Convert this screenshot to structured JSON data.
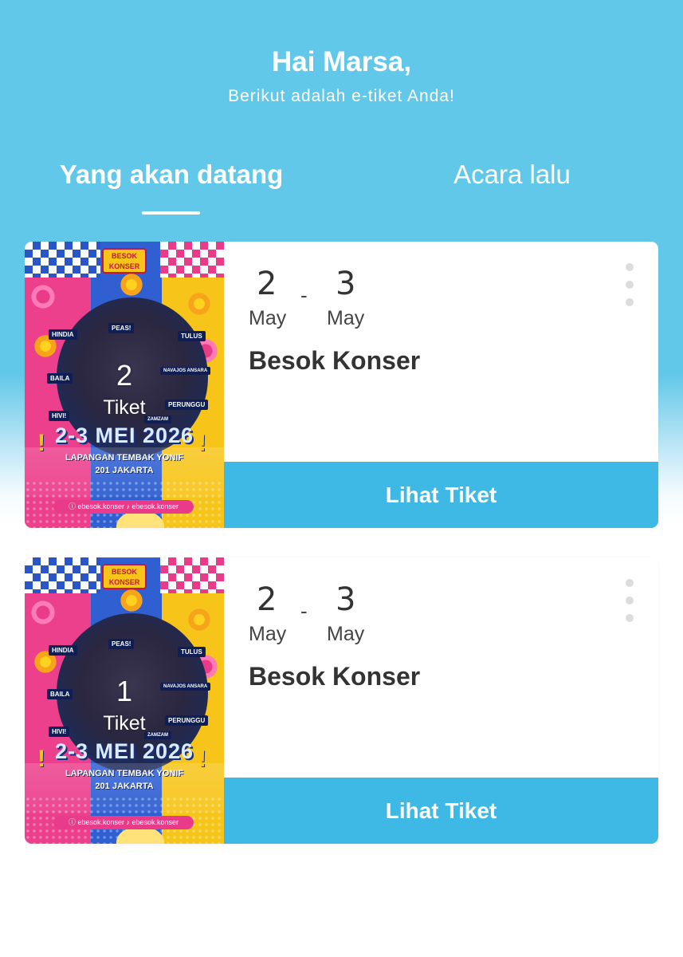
{
  "header": {
    "greeting": "Hai Marsa,",
    "subtitle": "Berikut adalah e-tiket Anda!"
  },
  "tabs": {
    "upcoming": "Yang akan datang",
    "past": "Acara lalu",
    "active": "upcoming"
  },
  "colors": {
    "header_bg": "#62c8e9",
    "button_bg": "#3eb8e5",
    "text_dark": "#333333"
  },
  "poster": {
    "logo_line1": "BESOK",
    "logo_line2": "KONSER",
    "date_text": "2-3 MEI 2026",
    "venue_line1": "LAPANGAN TEMBAK YONIF",
    "venue_line2": "201 JAKARTA",
    "socials": "ⓘ ebesok.konser   ♪ ebesok.konser",
    "artists": [
      "HINDIA",
      "PEAS!",
      "TULUS",
      "BAILA",
      "HIVI!",
      "PERUNGGU",
      "NAVAJOS ANSARA",
      "ZAMZAM"
    ]
  },
  "tickets": [
    {
      "count": "2",
      "count_label": "Tiket",
      "start_day": "2",
      "start_month": "May",
      "separator": "-",
      "end_day": "3",
      "end_month": "May",
      "title": "Besok Konser",
      "button": "Lihat Tiket",
      "menu_icon": "more-vertical-icon"
    },
    {
      "count": "1",
      "count_label": "Tiket",
      "start_day": "2",
      "start_month": "May",
      "separator": "-",
      "end_day": "3",
      "end_month": "May",
      "title": "Besok Konser",
      "button": "Lihat Tiket",
      "menu_icon": "more-vertical-icon"
    }
  ]
}
